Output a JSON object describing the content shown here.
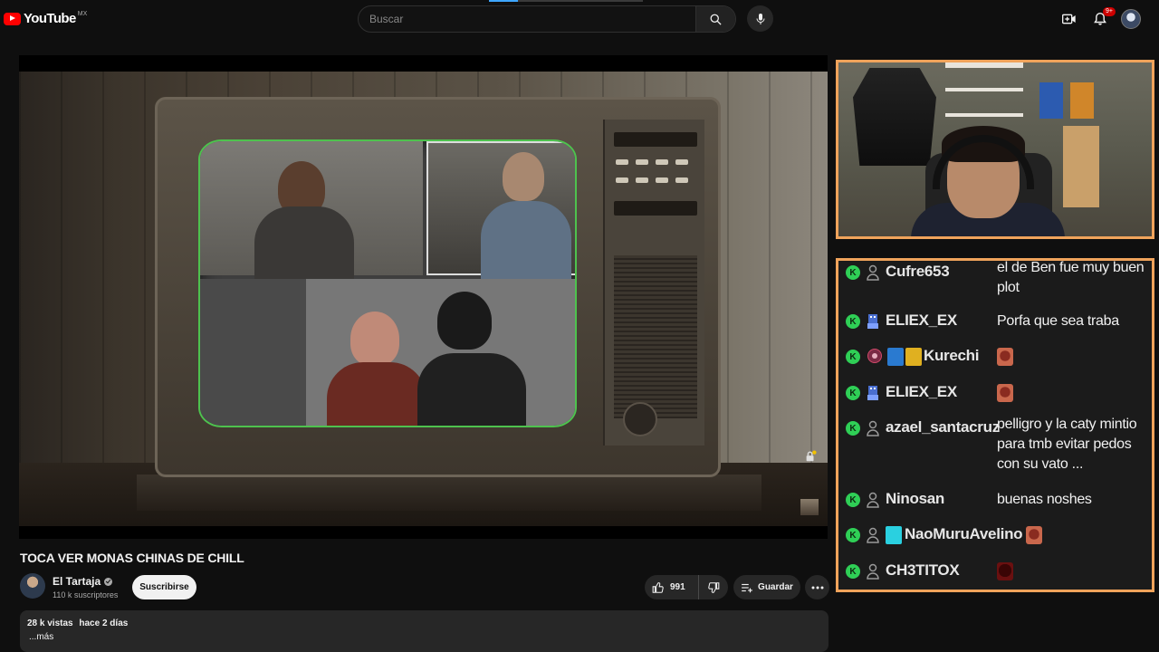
{
  "header": {
    "logo_text": "YouTube",
    "region": "MX",
    "search_placeholder": "Buscar",
    "notifications_badge": "9+"
  },
  "video": {
    "title": "TOCA VER MONAS CHINAS DE CHILL",
    "channel": {
      "name": "El Tartaja",
      "subscribers": "110 k suscriptores",
      "subscribe_label": "Suscribirse"
    },
    "likes": "991",
    "save_label": "Guardar",
    "description": {
      "views": "28 k vistas",
      "age": "hace 2 días",
      "more": "...más"
    }
  },
  "chat": {
    "badge_glyph": "K",
    "messages": [
      {
        "user": "Cufre653",
        "text": "el de Ben fue muy buen plot"
      },
      {
        "user": "ELIEX_EX",
        "text": "Porfa que sea traba"
      },
      {
        "user": "Kurechi",
        "text": ""
      },
      {
        "user": "ELIEX_EX",
        "text": ""
      },
      {
        "user": "azael_santacruz",
        "text": "pelligro y la caty mintio para tmb evitar pedos con su vato ..."
      },
      {
        "user": "Ninosan",
        "text": "buenas noshes"
      },
      {
        "user": "NaoMuruAvelino",
        "text": ""
      },
      {
        "user": "CH3TITOX",
        "text": ""
      }
    ]
  },
  "colors": {
    "overlay_border": "#f0a35b",
    "badge_green": "#2fcf56",
    "brand_red": "#ff0000"
  }
}
